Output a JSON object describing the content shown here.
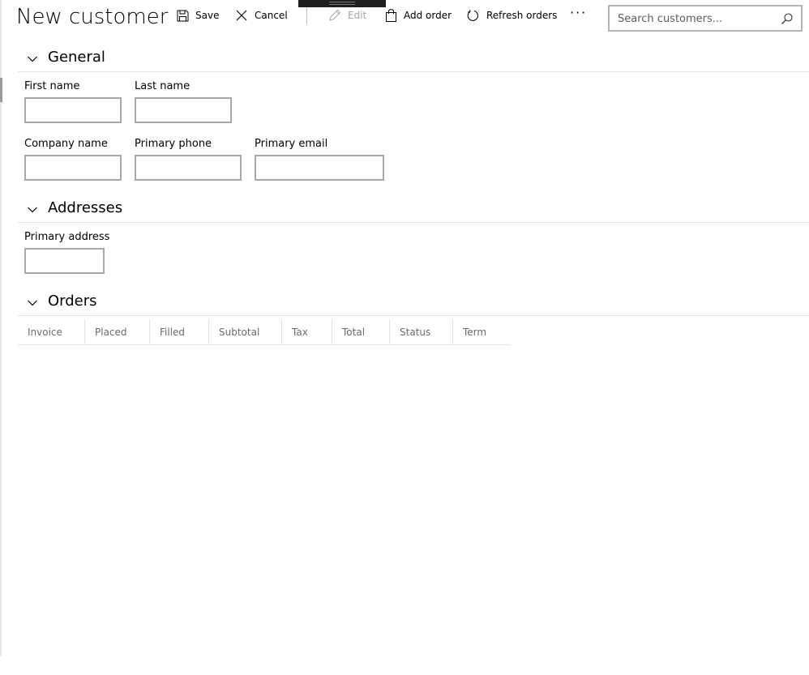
{
  "page": {
    "title": "New customer"
  },
  "toolbar": {
    "save": "Save",
    "cancel": "Cancel",
    "edit": "Edit",
    "add_order": "Add order",
    "refresh_orders": "Refresh orders",
    "more": "···"
  },
  "search": {
    "placeholder": "Search customers..."
  },
  "sections": {
    "general": "General",
    "addresses": "Addresses",
    "orders": "Orders"
  },
  "fields": {
    "first_name": {
      "label": "First name",
      "value": ""
    },
    "last_name": {
      "label": "Last name",
      "value": ""
    },
    "company_name": {
      "label": "Company name",
      "value": ""
    },
    "primary_phone": {
      "label": "Primary phone",
      "value": ""
    },
    "primary_email": {
      "label": "Primary email",
      "value": ""
    },
    "primary_address": {
      "label": "Primary address",
      "value": ""
    }
  },
  "orders_grid": {
    "columns": [
      "Invoice",
      "Placed",
      "Filled",
      "Subtotal",
      "Tax",
      "Total",
      "Status",
      "Term"
    ]
  },
  "icons": {
    "save": "floppy-disk-icon",
    "cancel": "close-icon",
    "edit": "pencil-icon",
    "add_order": "shopping-bag-icon",
    "refresh": "refresh-icon",
    "search": "search-icon",
    "chevron": "chevron-down-icon"
  }
}
